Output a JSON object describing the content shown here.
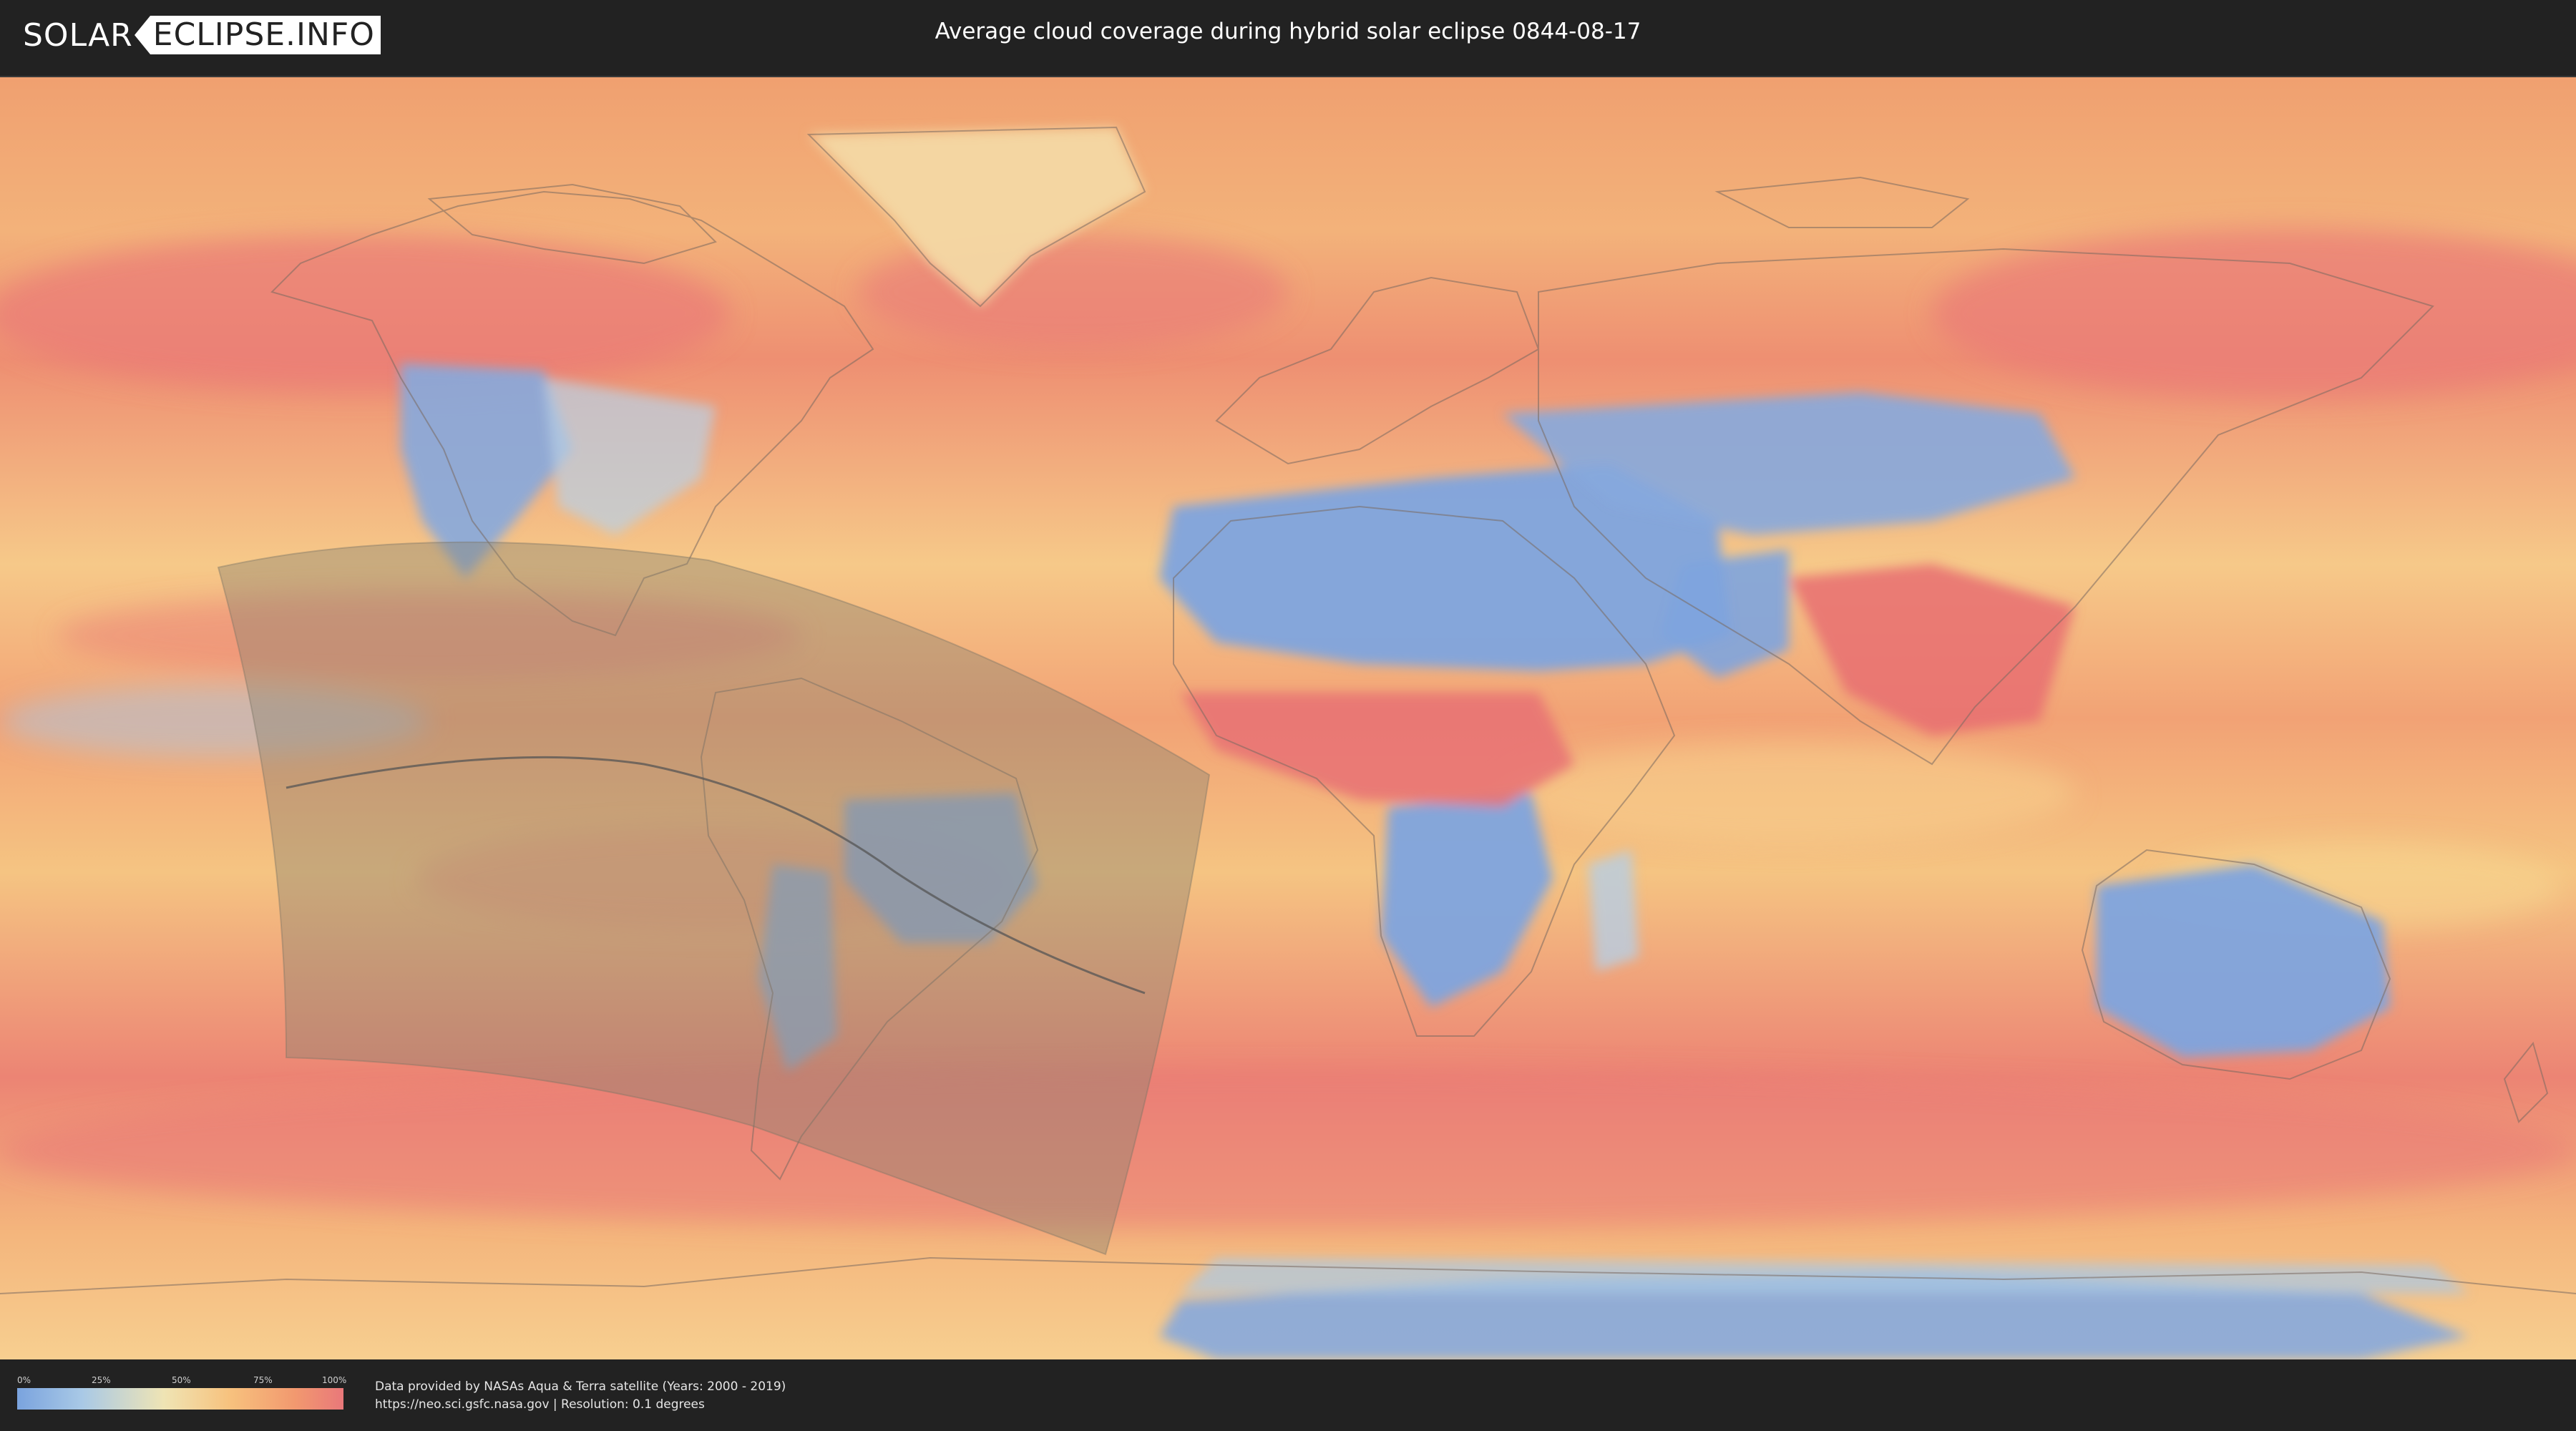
{
  "header": {
    "logo_left": "SOLAR",
    "logo_right": "ECLIPSE.INFO",
    "title": "Average cloud coverage during hybrid solar eclipse 0844-08-17"
  },
  "map": {
    "colors": {
      "clear": "#7aa3de",
      "low": "#a9c9e6",
      "mid": "#efe4b4",
      "high": "#f7c27e",
      "overcast": "#e9787a",
      "eclipse_zone": "#8a8370",
      "central_line": "#555555",
      "coastline": "#7a6a60"
    }
  },
  "legend": {
    "ticks": [
      "0%",
      "25%",
      "50%",
      "75%",
      "100%"
    ],
    "tick_values": [
      0,
      25,
      50,
      75,
      100
    ]
  },
  "footer": {
    "credit_line1": "Data provided by NASAs Aqua & Terra satellite (Years: 2000 - 2019)",
    "credit_line2": "https://neo.sci.gsfc.nasa.gov | Resolution: 0.1 degrees"
  }
}
